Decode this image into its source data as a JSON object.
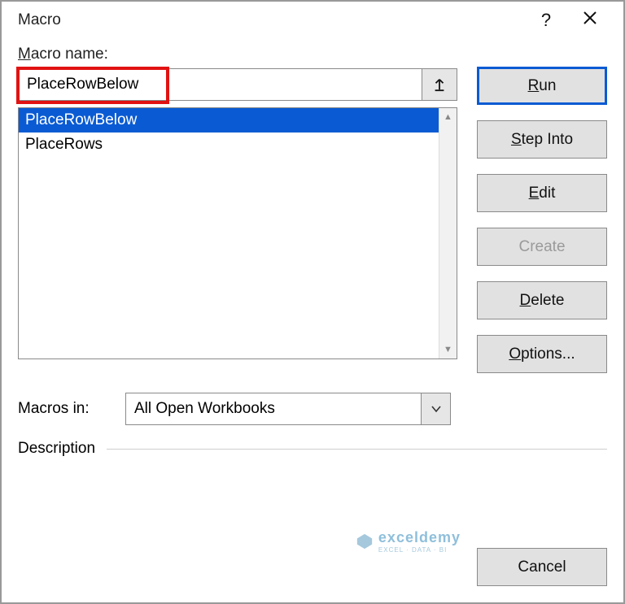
{
  "dialog": {
    "title": "Macro",
    "macro_name_label": "Macro name:",
    "macro_name_value": "PlaceRowBelow",
    "list_items": [
      "PlaceRowBelow",
      "PlaceRows"
    ],
    "selected_index": 0,
    "macros_in_label": "Macros in:",
    "macros_in_value": "All Open Workbooks",
    "description_label": "Description"
  },
  "buttons": {
    "run": "Run",
    "step_into": "Step Into",
    "edit": "Edit",
    "create": "Create",
    "delete": "Delete",
    "options": "Options...",
    "cancel": "Cancel"
  },
  "watermark": {
    "main": "exceldemy",
    "sub": "EXCEL · DATA · BI"
  }
}
